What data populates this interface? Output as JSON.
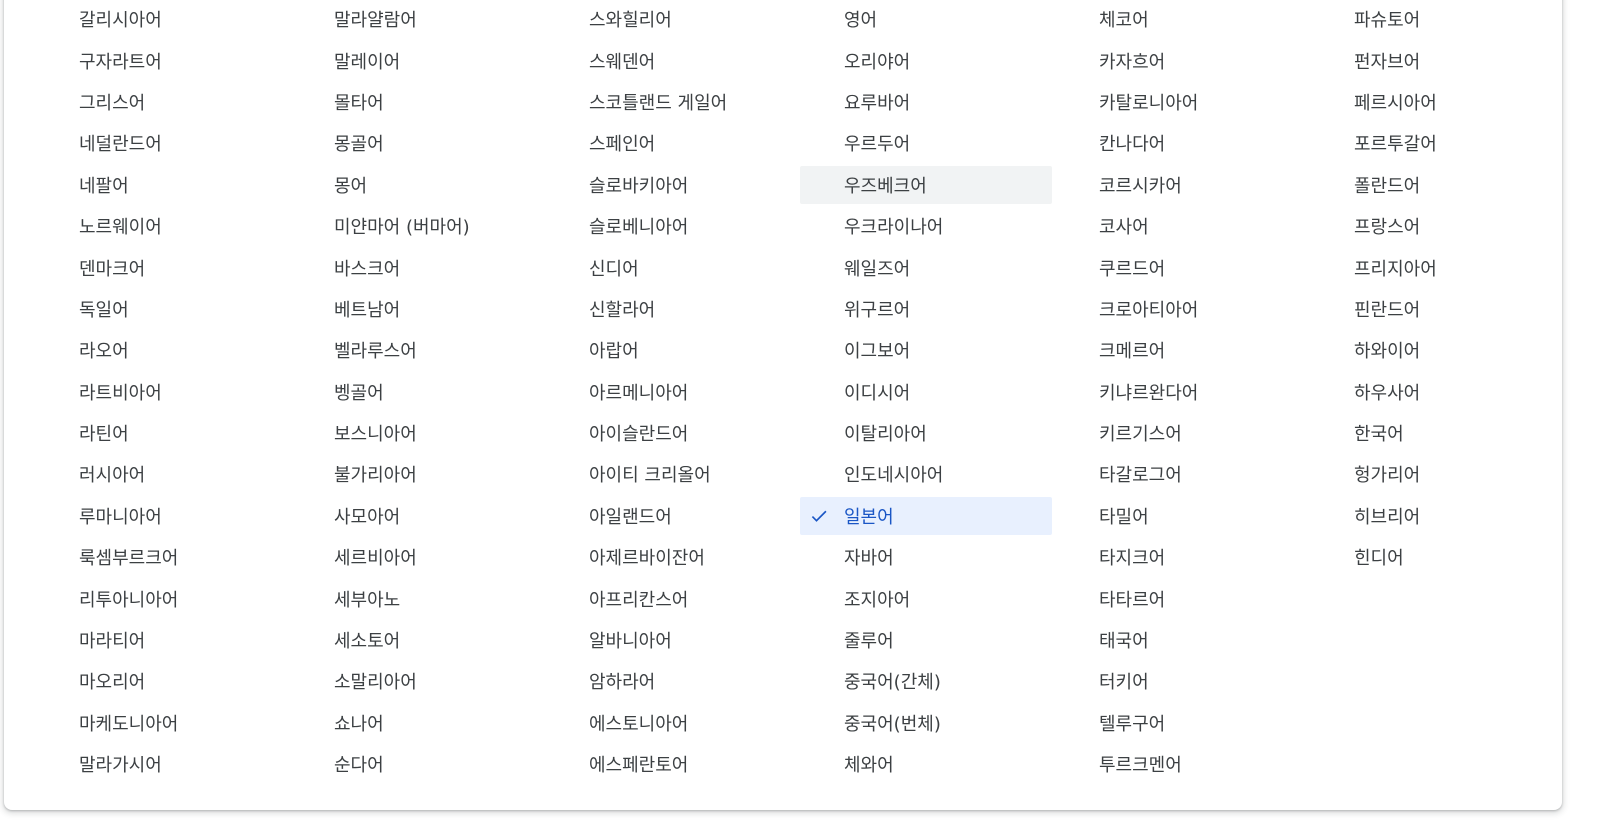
{
  "colors": {
    "text": "#3c4043",
    "selected_bg": "#e8f0fe",
    "selected_text": "#1a56c5",
    "hover_bg": "#f1f3f4"
  },
  "selected_language": "일본어",
  "hovered_language": "우즈베크어",
  "check_icon": "checkmark-icon",
  "columns": [
    [
      "갈리시아어",
      "구자라트어",
      "그리스어",
      "네덜란드어",
      "네팔어",
      "노르웨이어",
      "덴마크어",
      "독일어",
      "라오어",
      "라트비아어",
      "라틴어",
      "러시아어",
      "루마니아어",
      "룩셈부르크어",
      "리투아니아어",
      "마라티어",
      "마오리어",
      "마케도니아어",
      "말라가시어"
    ],
    [
      "말라얄람어",
      "말레이어",
      "몰타어",
      "몽골어",
      "몽어",
      "미얀마어 (버마어)",
      "바스크어",
      "베트남어",
      "벨라루스어",
      "벵골어",
      "보스니아어",
      "불가리아어",
      "사모아어",
      "세르비아어",
      "세부아노",
      "세소토어",
      "소말리아어",
      "쇼나어",
      "순다어"
    ],
    [
      "스와힐리어",
      "스웨덴어",
      "스코틀랜드 게일어",
      "스페인어",
      "슬로바키아어",
      "슬로베니아어",
      "신디어",
      "신할라어",
      "아랍어",
      "아르메니아어",
      "아이슬란드어",
      "아이티 크리올어",
      "아일랜드어",
      "아제르바이잔어",
      "아프리칸스어",
      "알바니아어",
      "암하라어",
      "에스토니아어",
      "에스페란토어"
    ],
    [
      "영어",
      "오리야어",
      "요루바어",
      "우르두어",
      "우즈베크어",
      "우크라이나어",
      "웨일즈어",
      "위구르어",
      "이그보어",
      "이디시어",
      "이탈리아어",
      "인도네시아어",
      "일본어",
      "자바어",
      "조지아어",
      "줄루어",
      "중국어(간체)",
      "중국어(번체)",
      "체와어"
    ],
    [
      "체코어",
      "카자흐어",
      "카탈로니아어",
      "칸나다어",
      "코르시카어",
      "코사어",
      "쿠르드어",
      "크로아티아어",
      "크메르어",
      "키냐르완다어",
      "키르기스어",
      "타갈로그어",
      "타밀어",
      "타지크어",
      "타타르어",
      "태국어",
      "터키어",
      "텔루구어",
      "투르크멘어"
    ],
    [
      "파슈토어",
      "펀자브어",
      "페르시아어",
      "포르투갈어",
      "폴란드어",
      "프랑스어",
      "프리지아어",
      "핀란드어",
      "하와이어",
      "하우사어",
      "한국어",
      "헝가리어",
      "히브리어",
      "힌디어"
    ]
  ]
}
